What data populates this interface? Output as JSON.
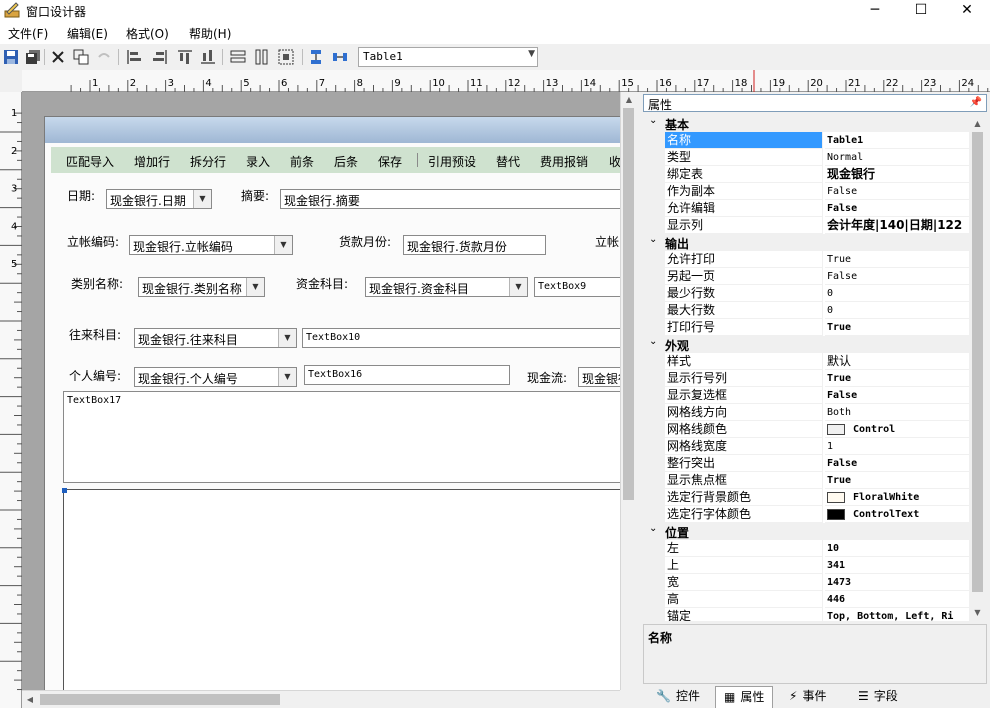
{
  "window": {
    "title": "窗口设计器"
  },
  "menu": [
    "文件(F)",
    "编辑(E)",
    "格式(O)",
    "帮助(H)"
  ],
  "toolbar": {
    "object_combo": "Table1"
  },
  "ruler": {
    "h_numbers": [
      "1",
      "2",
      "3",
      "4",
      "5",
      "6",
      "7",
      "8",
      "9",
      "10",
      "11",
      "12",
      "13",
      "14",
      "15",
      "16",
      "17",
      "18",
      "19",
      "20",
      "21",
      "22",
      "23",
      "24"
    ],
    "v_numbers": [
      "1",
      "2",
      "3",
      "4",
      "5"
    ]
  },
  "form": {
    "toolbar_items": [
      "匹配导入",
      "增加行",
      "拆分行",
      "录入",
      "前条",
      "后条",
      "保存",
      "引用预设",
      "替代",
      "费用报销",
      "收"
    ],
    "fields": {
      "date_label": "日期:",
      "date_value": "现金银行.日期",
      "summary_label": "摘要:",
      "summary_value": "现金银行.摘要",
      "voucher_label": "立帐编码:",
      "voucher_value": "现金银行.立帐编码",
      "month_label": "货款月份:",
      "month_value": "现金银行.货款月份",
      "voucher2_label": "立帐",
      "category_label": "类别名称:",
      "category_value": "现金银行.类别名称",
      "fund_label": "资金科目:",
      "fund_value": "现金银行.资金科目",
      "textbox9": "TextBox9",
      "account_label": "往来科目:",
      "account_value": "现金银行.往来科目",
      "textbox10": "TextBox10",
      "person_label": "个人编号:",
      "person_value": "现金银行.个人编号",
      "textbox16": "TextBox16",
      "cashflow_label": "现金流:",
      "cashflow_value": "现金银行",
      "textbox17": "TextBox17"
    }
  },
  "properties": {
    "header": "属性",
    "categories": [
      {
        "name": "基本",
        "rows": [
          {
            "name": "名称",
            "value": "Table1",
            "bold": true,
            "selected": true
          },
          {
            "name": "类型",
            "value": "Normal"
          },
          {
            "name": "绑定表",
            "value": "现金银行",
            "bold": true,
            "cjk": true
          },
          {
            "name": "作为副本",
            "value": "False"
          },
          {
            "name": "允许编辑",
            "value": "False",
            "bold": true
          },
          {
            "name": "显示列",
            "value": "会计年度|140|日期|122",
            "bold": true,
            "cjk": true
          }
        ]
      },
      {
        "name": "输出",
        "rows": [
          {
            "name": "允许打印",
            "value": "True"
          },
          {
            "name": "另起一页",
            "value": "False"
          },
          {
            "name": "最少行数",
            "value": "0"
          },
          {
            "name": "最大行数",
            "value": "0"
          },
          {
            "name": "打印行号",
            "value": "True",
            "bold": true
          }
        ]
      },
      {
        "name": "外观",
        "rows": [
          {
            "name": "样式",
            "value": "默认",
            "cjk": true
          },
          {
            "name": "显示行号列",
            "value": "True",
            "bold": true
          },
          {
            "name": "显示复选框",
            "value": "False",
            "bold": true
          },
          {
            "name": "网格线方向",
            "value": "Both"
          },
          {
            "name": "网格线颜色",
            "value": "Control",
            "bold": true,
            "swatch": "#f0f0f0"
          },
          {
            "name": "网格线宽度",
            "value": "1"
          },
          {
            "name": "整行突出",
            "value": "False",
            "bold": true
          },
          {
            "name": "显示焦点框",
            "value": "True",
            "bold": true
          },
          {
            "name": "选定行背景颜色",
            "value": "FloralWhite",
            "bold": true,
            "swatch": "#fffaf0"
          },
          {
            "name": "选定行字体颜色",
            "value": "ControlText",
            "bold": true,
            "swatch": "#000000"
          }
        ]
      },
      {
        "name": "位置",
        "rows": [
          {
            "name": "左",
            "value": "10",
            "bold": true
          },
          {
            "name": "上",
            "value": "341",
            "bold": true
          },
          {
            "name": "宽",
            "value": "1473",
            "bold": true
          },
          {
            "name": "高",
            "value": "446",
            "bold": true
          },
          {
            "name": "锚定",
            "value": "Top, Bottom, Left, Ri",
            "bold": true
          }
        ]
      }
    ],
    "description_title": "名称",
    "tabs": [
      {
        "label": "控件",
        "icon": "wrench-icon"
      },
      {
        "label": "属性",
        "icon": "property-icon",
        "active": true
      },
      {
        "label": "事件",
        "icon": "lightning-icon"
      },
      {
        "label": "字段",
        "icon": "list-icon"
      }
    ]
  },
  "colors": {
    "selection": "#3399ff",
    "form_toolbar": "#cfe2cf",
    "design_bg": "#a5a5a5"
  }
}
